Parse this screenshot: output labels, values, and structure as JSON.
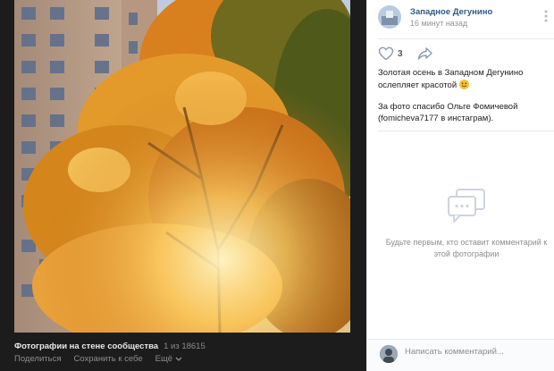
{
  "viewer": {
    "album_title": "Фотографии на стене сообщества",
    "counter": "1 из 18615",
    "actions": {
      "share": "Поделиться",
      "save": "Сохранить к себе",
      "more": "Ещё"
    }
  },
  "post": {
    "group_name": "Западное Дегунино",
    "time": "16 минут назад",
    "likes": "3",
    "text_line1": "Золотая осень в Западном Дегунино ослепляет красотой",
    "text_line2": "За фото спасибо Ольге Фомичевой (fomicheva7177 в инстаграм)."
  },
  "comments": {
    "empty_message": "Будьте первым, кто оставит комментарий к этой фотографии",
    "input_placeholder": "Написать комментарий..."
  },
  "colors": {
    "viewer_bg": "#1c1c1d",
    "link": "#2a5885",
    "autumn_orange": "#e8901c"
  }
}
